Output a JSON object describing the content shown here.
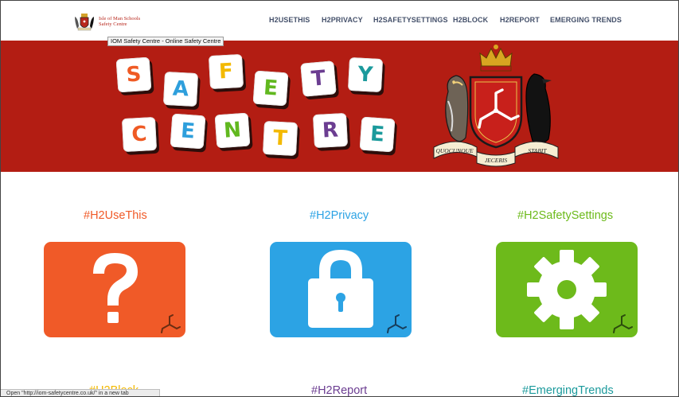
{
  "site": {
    "logo_line1": "Isle of Man Schools",
    "logo_line2": "Safety Centre"
  },
  "nav": {
    "items": [
      "H2USETHIS",
      "H2PRIVACY",
      "H2SAFETYSETTINGS",
      "H2BLOCK",
      "H2REPORT",
      "EMERGING TRENDS"
    ]
  },
  "tooltip": "IOM Safety Centre - Online Safety Centre",
  "hero": {
    "row1": [
      "S",
      "A",
      "F",
      "E",
      "T",
      "Y"
    ],
    "row2": [
      "C",
      "E",
      "N",
      "T",
      "R",
      "E"
    ],
    "motto": [
      "QUOCUNQUE",
      "JECERIS",
      "STABIT"
    ],
    "colors": {
      "background": "#b31d13",
      "orange": "#ef5a24",
      "blue": "#2e9fdc",
      "yellow": "#f3b900",
      "green": "#61b81f",
      "purple": "#6b3d91",
      "teal": "#1b9a9c"
    }
  },
  "cards": [
    {
      "title": "#H2UseThis",
      "icon": "question-mark-icon",
      "color": "#f05a28"
    },
    {
      "title": "#H2Privacy",
      "icon": "padlock-icon",
      "color": "#2ca3e4"
    },
    {
      "title": "#H2SafetySettings",
      "icon": "gear-icon",
      "color": "#6dba1b"
    }
  ],
  "bottom_titles": [
    {
      "title": "#H2Block",
      "color": "#f3b900"
    },
    {
      "title": "#H2Report",
      "color": "#6b3d91"
    },
    {
      "title": "#EmergingTrends",
      "color": "#1b9a9c"
    }
  ],
  "status_bar": "Open \"http://iom-safetycentre.co.uk/\" in a new tab"
}
